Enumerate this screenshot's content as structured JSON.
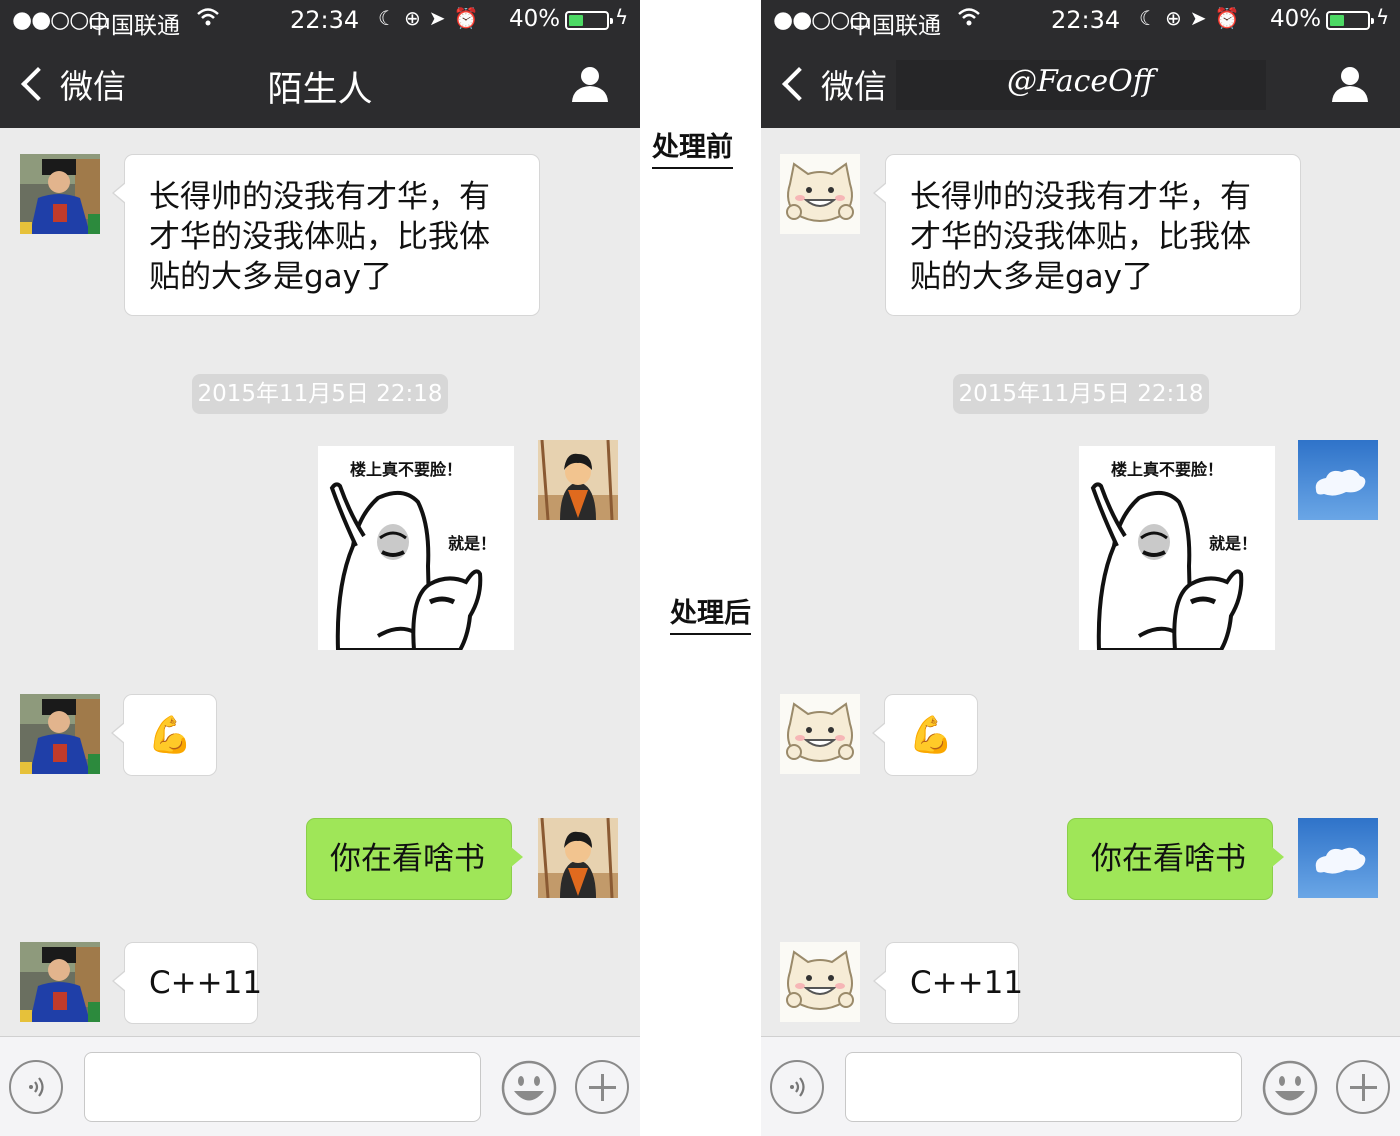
{
  "labels": {
    "before": "处理前",
    "after": "处理后"
  },
  "status": {
    "carrier": "中国联通",
    "signal": "●●○○○",
    "time": "22:34",
    "battery": "40%",
    "battery_level": 0.4
  },
  "left": {
    "back_label": "微信",
    "title": "陌生人",
    "messages": {
      "long": "长得帅的没我有才华，有才华的没我体贴，比我体贴的大多是gay了",
      "timestamp": "2015年11月5日 22:18",
      "sticker_line1": "楼上真不要脸！",
      "sticker_line2": "就是！",
      "emoji": "💪",
      "sent": "你在看啥书",
      "reply": "C++11"
    }
  },
  "right": {
    "back_label": "微信",
    "title": "@FaceOff",
    "messages": {
      "long": "长得帅的没我有才华，有才华的没我体贴，比我体贴的大多是gay了",
      "timestamp": "2015年11月5日 22:18",
      "sticker_line1": "楼上真不要脸！",
      "sticker_line2": "就是！",
      "emoji": "💪",
      "sent": "你在看啥书",
      "reply": "C++11"
    }
  },
  "colors": {
    "navbar": "#2c2c2e",
    "chat_bg": "#ebebeb",
    "sent_bubble": "#9fe658",
    "battery_fill": "#4cd964"
  },
  "icons": [
    "back-chevron-icon",
    "person-icon",
    "voice-icon",
    "emoji-face-icon",
    "plus-icon",
    "wifi-icon",
    "moon-icon",
    "lock-rotation-icon",
    "location-arrow-icon",
    "alarm-icon",
    "charging-bolt-icon"
  ]
}
